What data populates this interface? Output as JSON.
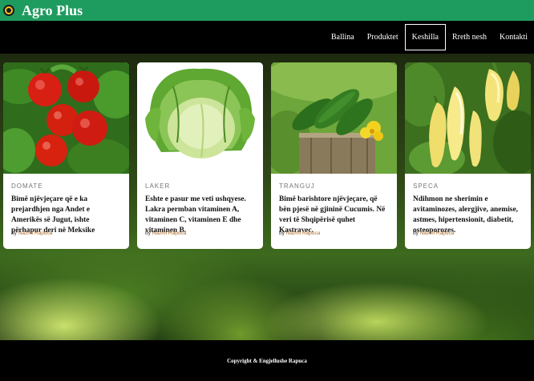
{
  "brand": {
    "title": "Agro Plus"
  },
  "nav": {
    "items": [
      {
        "label": "Ballina"
      },
      {
        "label": "Produktet"
      },
      {
        "label": "Keshilla",
        "active": true
      },
      {
        "label": "Rreth nesh"
      },
      {
        "label": "Kontakti"
      }
    ]
  },
  "cards": [
    {
      "image": "tomatoes-photo",
      "category": "DOMATE",
      "text": "Bimë njëvjeçare që e ka prejardhjen nga Andet e Amerikës së Jugut, ishte përhapur deri në Meksike",
      "by": "by",
      "author": "Nazmi Rapuca"
    },
    {
      "image": "cabbage-photo",
      "category": "LAKER",
      "text": "Eshte e pasur me veti ushqyese. Lakra permban vitaminen A, vitaminen C, vitaminen E dhe vitaminen B.",
      "by": "by",
      "author": "Nazmi Rapuca"
    },
    {
      "image": "cucumbers-photo",
      "category": "TRANGUJ",
      "text": "Bimë barishtore njëvjeçare, që bën pjesë në gjininë Cucumis. Në veri të Shqipërisë quhet Kastravec.",
      "by": "by",
      "author": "Nazmi Rapuca"
    },
    {
      "image": "peppers-photo",
      "category": "SPECA",
      "text": "Ndihmon ne sherimin e avitaminozes, alergjive, anemise, astmes, hipertensionit, diabetit, osteoporozes.",
      "by": "by",
      "author": "Nazmi Rapuca"
    }
  ],
  "footer": {
    "text": "Copyright & Engjellushe Rapuca"
  },
  "colors": {
    "brand_green": "#1e9b5e",
    "nav_bg": "#000000",
    "author_link": "#b06c2a"
  }
}
